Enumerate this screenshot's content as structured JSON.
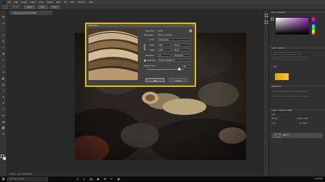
{
  "app": {
    "logo": "Ps"
  },
  "menu": [
    "File",
    "Edit",
    "Image",
    "Layer",
    "Type",
    "Select",
    "Filter",
    "3D",
    "View",
    "Window",
    "Help"
  ],
  "options_bar": {
    "field1": "Full Size",
    "btn1": "Resize",
    "btn2": "Crop",
    "btn3": "Clear"
  },
  "doc_tab": {
    "title": "SNAIL.jpg @ 33.3% (RGB/8)",
    "close": "×"
  },
  "tools": [
    {
      "name": "move-tool-icon",
      "glyph": "✥"
    },
    {
      "name": "marquee-tool-icon",
      "glyph": "▭"
    },
    {
      "name": "lasso-tool-icon",
      "glyph": "◌"
    },
    {
      "name": "quick-select-tool-icon",
      "glyph": "✎"
    },
    {
      "name": "crop-tool-icon",
      "glyph": "⌗"
    },
    {
      "name": "eyedropper-tool-icon",
      "glyph": "✑"
    },
    {
      "name": "healing-tool-icon",
      "glyph": "✚"
    },
    {
      "name": "brush-tool-icon",
      "glyph": "✏"
    },
    {
      "name": "stamp-tool-icon",
      "glyph": "⊥"
    },
    {
      "name": "history-brush-tool-icon",
      "glyph": "↺"
    },
    {
      "name": "eraser-tool-icon",
      "glyph": "◧"
    },
    {
      "name": "gradient-tool-icon",
      "glyph": "▤"
    },
    {
      "name": "blur-tool-icon",
      "glyph": "◊"
    },
    {
      "name": "dodge-tool-icon",
      "glyph": "●"
    },
    {
      "name": "pen-tool-icon",
      "glyph": "✒"
    },
    {
      "name": "type-tool-icon",
      "glyph": "T"
    },
    {
      "name": "path-select-tool-icon",
      "glyph": "➤"
    },
    {
      "name": "shape-tool-icon",
      "glyph": "▬"
    },
    {
      "name": "hand-tool-icon",
      "glyph": "✋"
    },
    {
      "name": "zoom-tool-icon",
      "glyph": "⚲"
    }
  ],
  "dialog": {
    "title": "Image Size",
    "close": "×",
    "image_size_label": "Image Size:",
    "image_size_value": "33.3M",
    "dimensions_label": "Dimensions:",
    "dimensions_value": "4032 px × 3024 px",
    "fit_to_label": "Fit To:",
    "fit_to_value": "Original Size",
    "width_label": "Width:",
    "width_value": "4032",
    "width_unit": "Pixels",
    "height_label": "Height:",
    "height_value": "3024",
    "height_unit": "Pixels",
    "resolution_label": "Resolution:",
    "resolution_value": "72",
    "resolution_unit": "Pixels/Inch",
    "resample_label": "Resample:",
    "resample_value": "Preserve Details 2.0",
    "reduce_noise_label": "Reduce Noise:",
    "reduce_noise_value": "0%",
    "ok_label": "OK",
    "cancel_label": "Cancel"
  },
  "panels": {
    "color_tab": "Color",
    "swatches_tab": "Swatches",
    "learn_tab": "Learn",
    "libraries_tab": "Libraries",
    "adjustments_tab": "Adjustments",
    "layers_tab": "Layers",
    "channels_tab": "Channels",
    "paths_tab": "Paths",
    "layer_name": "Layer 0",
    "kind_label": "Kind",
    "blend_mode": "Normal",
    "opacity": "Opacity: 100%",
    "lock_label": "Lock:",
    "fill": "Fill: 100%"
  },
  "status": {
    "zoom": "33.33%",
    "doc": "Doc: 34.9M/34.9M"
  },
  "taskbar": {
    "start": "⊞",
    "search_placeholder": "Type here to search",
    "time": "11:42 AM"
  },
  "accent_color": "#f0c000"
}
